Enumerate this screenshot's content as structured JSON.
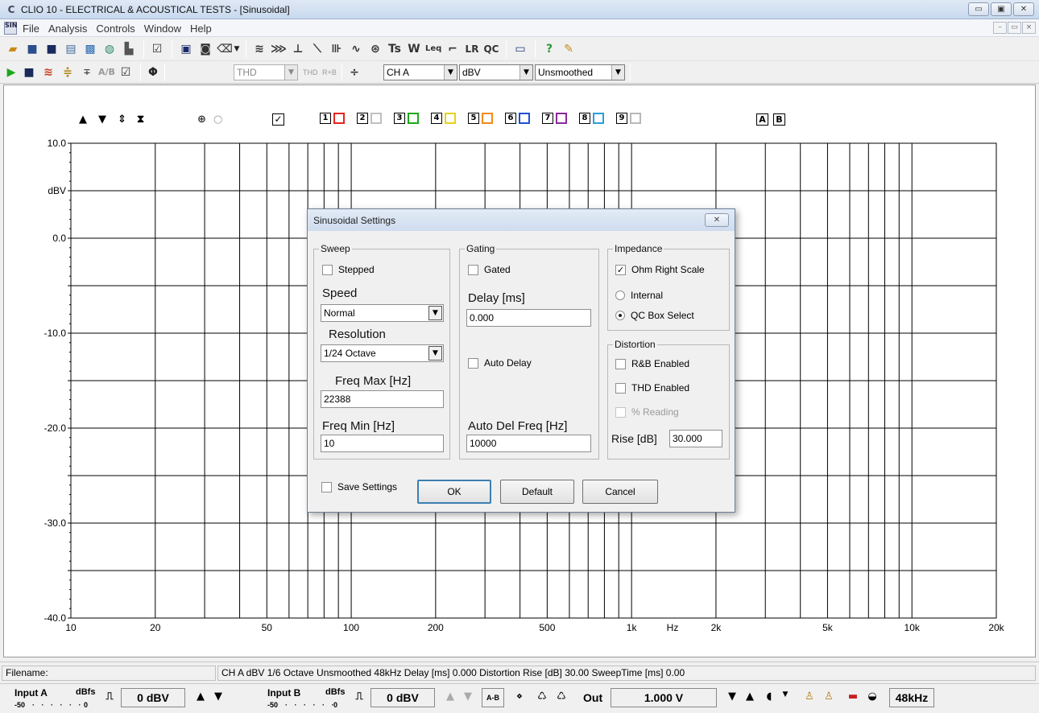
{
  "window": {
    "title": "CLIO 10 - ELECTRICAL & ACOUSTICAL TESTS - [Sinusoidal]",
    "app_icon": "C",
    "controls": [
      "▭",
      "▣",
      "✕"
    ]
  },
  "menu": {
    "items": [
      "File",
      "Analysis",
      "Controls",
      "Window",
      "Help"
    ],
    "mdi_icon": "SIN",
    "mdi_controls": [
      "–",
      "▭",
      "×"
    ]
  },
  "toolbar2": {
    "thd_combo": "THD",
    "thd_label": "THD",
    "rb_label": "R+B",
    "channel_combo": "CH A",
    "unit_combo": "dBV",
    "smoothing_combo": "Unsmoothed"
  },
  "graph": {
    "y_ticks": [
      "10.0",
      "0.0",
      "-10.0",
      "-20.0",
      "-30.0",
      "-40.0"
    ],
    "y_unit": "dBV",
    "x_ticks": [
      {
        "label": "10",
        "f": 10
      },
      {
        "label": "20",
        "f": 20
      },
      {
        "label": "50",
        "f": 50
      },
      {
        "label": "100",
        "f": 100
      },
      {
        "label": "200",
        "f": 200
      },
      {
        "label": "500",
        "f": 500
      },
      {
        "label": "1k",
        "f": 1000
      },
      {
        "label": "2k",
        "f": 2000
      },
      {
        "label": "5k",
        "f": 5000
      },
      {
        "label": "10k",
        "f": 10000
      },
      {
        "label": "20k",
        "f": 20000
      }
    ],
    "x_unit": "Hz",
    "x_range": [
      10,
      20000
    ],
    "y_range": [
      -40,
      10
    ],
    "curves": [
      {
        "num": "1",
        "color": "#e8231f"
      },
      {
        "num": "2",
        "color": "#c0c0c0"
      },
      {
        "num": "3",
        "color": "#1aa81a"
      },
      {
        "num": "4",
        "color": "#e5d21c"
      },
      {
        "num": "5",
        "color": "#f08a1c"
      },
      {
        "num": "6",
        "color": "#1c4fd8"
      },
      {
        "num": "7",
        "color": "#8a2a9c"
      },
      {
        "num": "8",
        "color": "#2c9ed8"
      },
      {
        "num": "9",
        "color": "#b8b8b8"
      }
    ],
    "ref_a": "A",
    "ref_b": "B",
    "checkbox_mark": "✓"
  },
  "dialog": {
    "title": "Sinusoidal Settings",
    "close": "✕",
    "sweep": {
      "label": "Sweep",
      "stepped": "Stepped",
      "speed_label": "Speed",
      "speed_value": "Normal",
      "resolution_label": "Resolution",
      "resolution_value": "1/24 Octave",
      "freq_max_label": "Freq Max [Hz]",
      "freq_max_value": "22388",
      "freq_min_label": "Freq Min [Hz]",
      "freq_min_value": "10"
    },
    "gating": {
      "label": "Gating",
      "gated": "Gated",
      "delay_label": "Delay [ms]",
      "delay_value": "0.000",
      "auto_delay": "Auto Delay",
      "auto_del_freq_label": "Auto Del Freq [Hz]",
      "auto_del_freq_value": "10000"
    },
    "impedance": {
      "label": "Impedance",
      "ohm_right_scale": "Ohm Right Scale",
      "internal": "Internal",
      "qc_box_select": "QC Box Select"
    },
    "distortion": {
      "label": "Distortion",
      "rb_enabled": "R&B Enabled",
      "thd_enabled": "THD Enabled",
      "percent_reading": "% Reading",
      "rise_label": "Rise [dB]",
      "rise_value": "30.000"
    },
    "save_settings": "Save Settings",
    "ok": "OK",
    "default": "Default",
    "cancel": "Cancel"
  },
  "status": {
    "filename_label": "Filename:",
    "info": "CH A  dBV  1/6 Octave  Unsmoothed  48kHz  Delay [ms] 0.000   Distortion Rise [dB] 30.00   SweepTime [ms] 0.00"
  },
  "bottom": {
    "input_a_label": "Input A",
    "input_b_label": "Input B",
    "scale_label": "dBfs",
    "scale_min": "-50",
    "scale_max": "0",
    "input_a_value": "0 dBV",
    "input_b_value": "0 dBV",
    "out_label": "Out",
    "out_value": "1.000 V",
    "ab_label": "A-B",
    "sample_rate": "48kHz"
  }
}
